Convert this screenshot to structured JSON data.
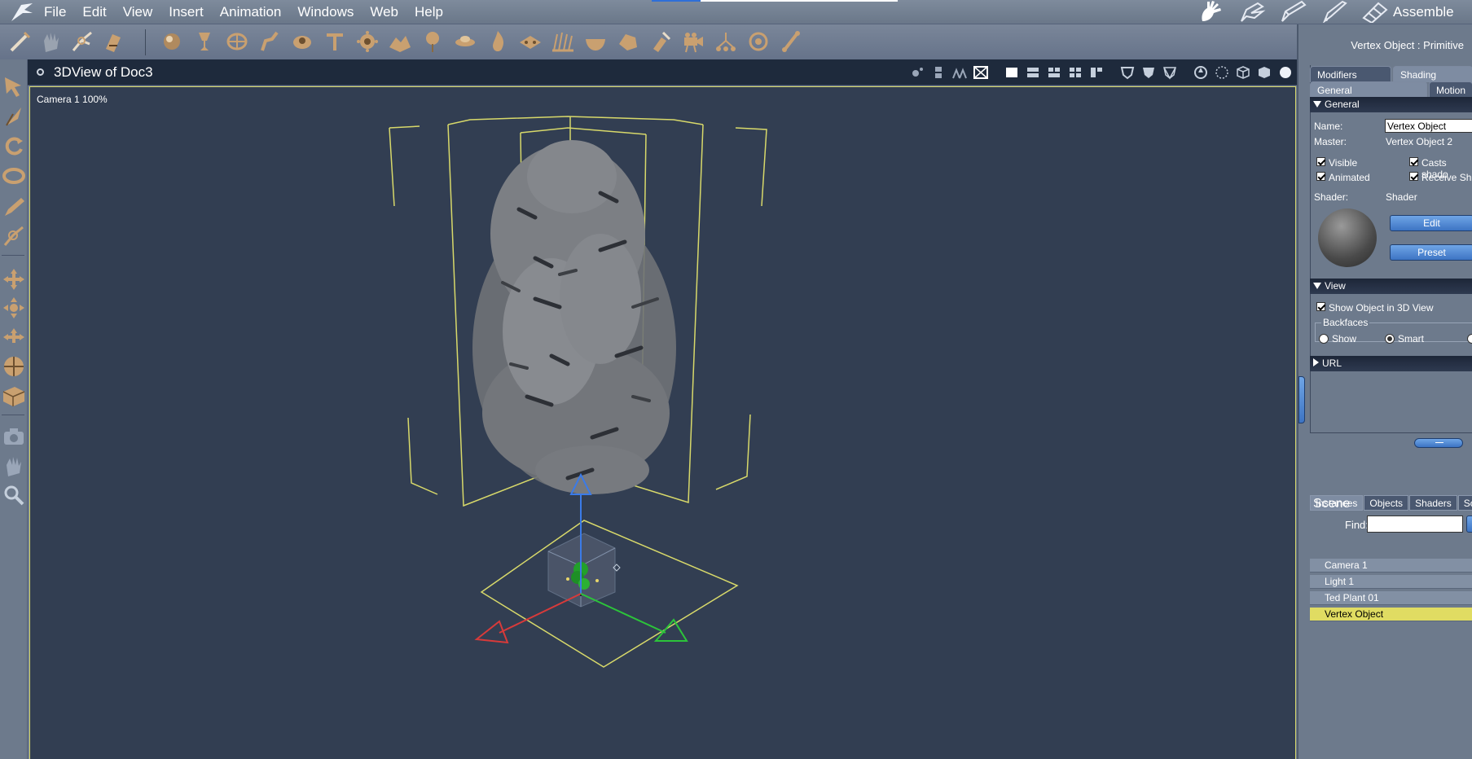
{
  "menu": {
    "items": [
      "File",
      "Edit",
      "View",
      "Insert",
      "Animation",
      "Windows",
      "Web",
      "Help"
    ],
    "room_label": "Assemble"
  },
  "viewport": {
    "title": "3DView of Doc3",
    "camera_label": "Camera 1 100%"
  },
  "right_panel": {
    "object_title": "Vertex Object : Primitive",
    "top_tabs": [
      "Modifiers",
      "Shading"
    ],
    "sub_tabs": [
      "General",
      "Motion"
    ],
    "general_section": "General",
    "name_label": "Name:",
    "name_value": "Vertex Object",
    "master_label": "Master:",
    "master_value": "Vertex Object 2",
    "checkbox_visible": "Visible",
    "checkbox_animated": "Animated",
    "checkbox_casts_shadows": "Casts shado",
    "checkbox_receive_shadows": "Receive Sh",
    "shader_label": "Shader:",
    "shader_value": "Shader",
    "edit_button": "Edit",
    "preset_button": "Preset",
    "view_section": "View",
    "show_in_3d": "Show Object in 3D View",
    "backfaces_label": "Backfaces",
    "radio_show": "Show",
    "radio_smart": "Smart",
    "url_section": "URL",
    "browser_tabs": [
      "Instances",
      "Objects",
      "Shaders",
      "Sc"
    ],
    "find_label": "Find:",
    "find_value": "",
    "scene_header": "Scene",
    "scene_items": [
      "Camera 1",
      "Light 1",
      "Ted Plant 01",
      "Vertex Object"
    ]
  },
  "colors": {
    "accent_blue": "#3d74c3",
    "selection_yellow": "#e0dc62",
    "viewport_bg": "#323e52",
    "bbox_yellow": "#d8d96a"
  }
}
